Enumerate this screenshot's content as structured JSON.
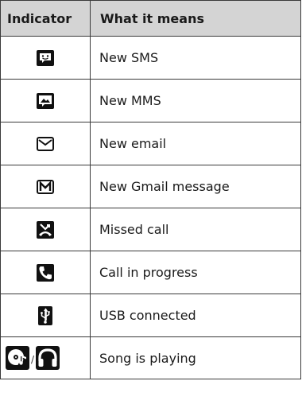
{
  "header": {
    "indicator": "Indicator",
    "meaning": "What it means"
  },
  "rows": [
    {
      "icon": "sms-bubble-icon",
      "meaning": "New SMS"
    },
    {
      "icon": "mms-picture-bubble-icon",
      "meaning": "New MMS"
    },
    {
      "icon": "email-envelope-icon",
      "meaning": "New email"
    },
    {
      "icon": "gmail-envelope-icon",
      "meaning": "New Gmail message"
    },
    {
      "icon": "missed-call-icon",
      "meaning": "Missed call"
    },
    {
      "icon": "call-in-progress-icon",
      "meaning": "Call in progress"
    },
    {
      "icon": "usb-icon",
      "meaning": "USB connected"
    },
    {
      "icons": [
        "music-disc-icon",
        "headphones-icon"
      ],
      "separator": "/",
      "meaning": "Song is playing"
    }
  ],
  "colors": {
    "icon_bg": "#111111",
    "icon_fg": "#ffffff",
    "header_bg": "#d4d4d4",
    "border": "#3a3a3a"
  }
}
